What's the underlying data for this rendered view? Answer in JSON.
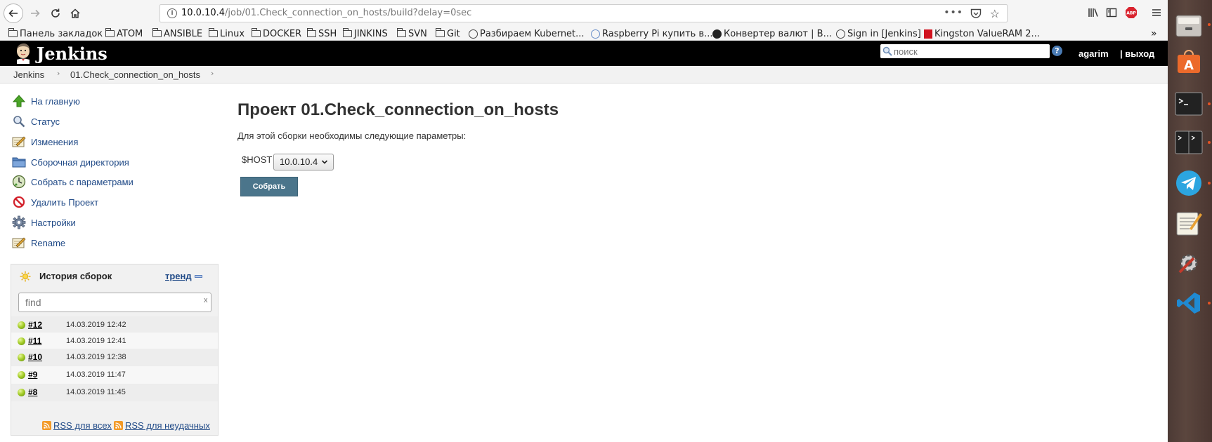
{
  "browser": {
    "url_host": "10.0.10.4",
    "url_path": "/job/01.Check_connection_on_hosts/build?delay=0sec",
    "bookmarks": [
      {
        "label": "Панель закладок",
        "icon": "folder-icon"
      },
      {
        "label": "ATOM",
        "icon": "folder-icon"
      },
      {
        "label": "ANSIBLE",
        "icon": "folder-icon"
      },
      {
        "label": "Linux",
        "icon": "folder-icon"
      },
      {
        "label": "DOCKER",
        "icon": "folder-icon"
      },
      {
        "label": "SSH",
        "icon": "folder-icon"
      },
      {
        "label": "JINKINS",
        "icon": "folder-icon"
      },
      {
        "label": "SVN",
        "icon": "folder-icon"
      },
      {
        "label": "Git",
        "icon": "folder-icon"
      },
      {
        "label": "Разбираем Kubernet...",
        "icon": "globe-icon"
      },
      {
        "label": "Raspberry Pi купить в...",
        "icon": "raspberry-icon"
      },
      {
        "label": "Конвертер валют | В...",
        "icon": "converter-icon"
      },
      {
        "label": "Sign in [Jenkins]",
        "icon": "globe-icon"
      },
      {
        "label": "Kingston ValueRAM 2...",
        "icon": "kingston-icon"
      }
    ]
  },
  "header": {
    "app_title": "Jenkins",
    "search_placeholder": "поиск",
    "user": "agarim",
    "logout": "| выход"
  },
  "breadcrumb": [
    "Jenkins",
    "01.Check_connection_on_hosts"
  ],
  "sidebar": {
    "tasks": [
      {
        "label": "На главную",
        "icon": "up-arrow-icon"
      },
      {
        "label": "Статус",
        "icon": "magnifier-icon"
      },
      {
        "label": "Изменения",
        "icon": "notepad-icon"
      },
      {
        "label": "Сборочная директория",
        "icon": "folder-icon"
      },
      {
        "label": "Собрать с параметрами",
        "icon": "clock-build-icon"
      },
      {
        "label": "Удалить Проект",
        "icon": "no-entry-icon"
      },
      {
        "label": "Настройки",
        "icon": "gear-icon"
      },
      {
        "label": "Rename",
        "icon": "notepad-icon"
      }
    ],
    "history": {
      "title": "История сборок",
      "trend": "тренд",
      "find_placeholder": "find",
      "clear": "x",
      "builds": [
        {
          "number": "#12",
          "date": "14.03.2019 12:42",
          "status": "success"
        },
        {
          "number": "#11",
          "date": "14.03.2019 12:41",
          "status": "success"
        },
        {
          "number": "#10",
          "date": "14.03.2019 12:38",
          "status": "success"
        },
        {
          "number": "#9",
          "date": "14.03.2019 11:47",
          "status": "success"
        },
        {
          "number": "#8",
          "date": "14.03.2019 11:45",
          "status": "success"
        }
      ],
      "rss_all": "RSS для всех",
      "rss_failed": "RSS для неудачных"
    }
  },
  "main": {
    "title": "Проект 01.Check_connection_on_hosts",
    "description": "Для этой сборки необходимы следующие параметры:",
    "param_name": "$HOST",
    "param_value": "10.0.10.4",
    "build_button": "Собрать"
  },
  "launcher": {
    "items": [
      "files-icon",
      "software-center-icon",
      "terminal-icon",
      "terminator-icon",
      "telegram-icon",
      "text-editor-icon",
      "settings-icon",
      "vscode-icon"
    ]
  },
  "colors": {
    "link": "#204a87",
    "build_button": "#4b758b",
    "header_bg": "#000000",
    "success_ball": "#a7cf2b"
  }
}
